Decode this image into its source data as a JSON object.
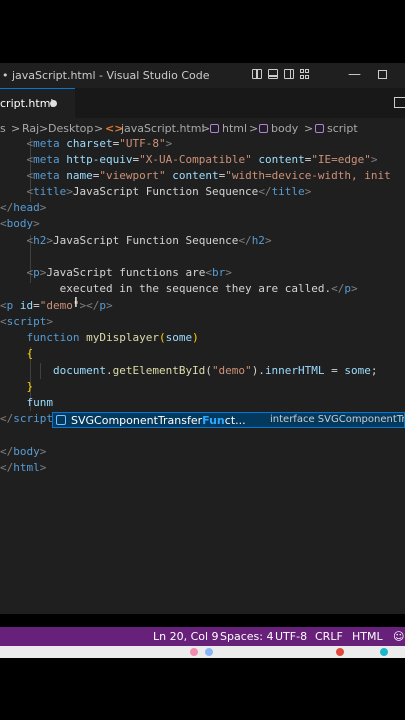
{
  "window": {
    "title": "javaScript.html - Visual Studio Code"
  },
  "tab": {
    "label": "cript.html"
  },
  "breadcrumb": {
    "items": [
      "s",
      "Raj",
      "Desktop",
      "javaScript.html",
      "html",
      "body",
      "script"
    ],
    "separator": ">"
  },
  "code": {
    "line1": {
      "indent": "    ",
      "tag": "meta",
      "a1": "charset",
      "v1": "\"UTF-8\""
    },
    "line2": {
      "indent": "    ",
      "tag": "meta",
      "a1": "http-equiv",
      "v1": "\"X-UA-Compatible\"",
      "a2": "content",
      "v2": "\"IE=edge\""
    },
    "line3": {
      "indent": "    ",
      "tag": "meta",
      "a1": "name",
      "v1": "\"viewport\"",
      "a2": "content",
      "v2": "\"width=device-width, init"
    },
    "line4": {
      "indent": "    ",
      "tag": "title",
      "text": "JavaScript Function Sequence"
    },
    "line5": {
      "tag": "head"
    },
    "line6": {
      "tag": "body"
    },
    "line7": {
      "indent": "    ",
      "tag": "h2",
      "text": "JavaScript Function Sequence"
    },
    "line9": {
      "indent": "    ",
      "tag": "p",
      "text": "JavaScript functions are",
      "br": "br"
    },
    "line10": {
      "indent": "         ",
      "text": "executed in the sequence they are called."
    },
    "line11": {
      "tag": "p",
      "a1": "id",
      "v1": "\"demo\""
    },
    "line12": {
      "tag": "script"
    },
    "line13": {
      "indent": "    ",
      "kw": "function",
      "fn": "myDisplayer",
      "param": "some"
    },
    "line14": {
      "indent": "    ",
      "brace": "{"
    },
    "line15": {
      "indent": "        ",
      "obj": "document",
      "method": "getElementById",
      "arg": "\"demo\"",
      "prop": "innerHTML",
      "val": "some"
    },
    "line16": {
      "indent": "    ",
      "brace": "}"
    },
    "line17": {
      "indent": "    ",
      "typed": "funm"
    },
    "line18": {
      "tag": "script"
    },
    "line20": {
      "tag": "body"
    },
    "line22": {
      "tag": "html"
    }
  },
  "suggestion": {
    "label_pre": "SVGComponentTransfer",
    "label_match": "Fun",
    "label_post": "ct...",
    "detail": "interface SVGComponentTr",
    "icon": "interface-icon"
  },
  "statusbar": {
    "position": "Ln 20, Col 9",
    "spaces": "Spaces: 4",
    "encoding": "UTF-8",
    "eol": "CRLF",
    "language": "HTML",
    "color": "#68217a"
  },
  "icons": {
    "title_layout": [
      "toggle-primary-sidebar-icon",
      "toggle-panel-icon",
      "toggle-secondary-sidebar-icon",
      "customize-layout-icon"
    ],
    "window_controls": [
      "minimize-icon",
      "maximize-icon"
    ]
  }
}
